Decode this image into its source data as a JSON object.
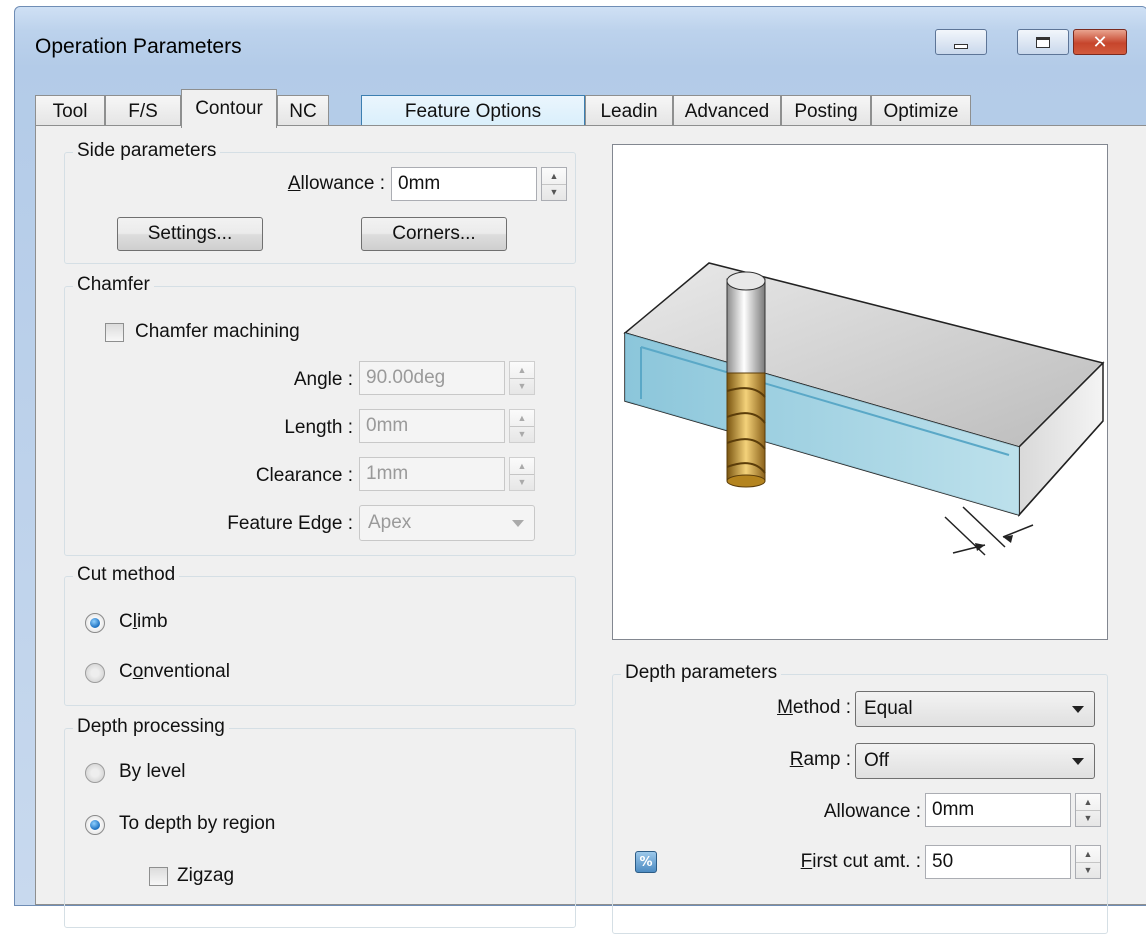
{
  "window": {
    "title": "Operation Parameters",
    "minimize_glyph": "—",
    "close_glyph": "✕"
  },
  "tabs": [
    {
      "label": "Tool"
    },
    {
      "label": "F/S"
    },
    {
      "label": "Contour",
      "active": true
    },
    {
      "label": "NC"
    },
    {
      "label": "Feature Options",
      "hover": true
    },
    {
      "label": "Leadin"
    },
    {
      "label": "Advanced"
    },
    {
      "label": "Posting"
    },
    {
      "label": "Optimize"
    }
  ],
  "side_parameters": {
    "group_label": "Side parameters",
    "allowance_label": "Allowance :",
    "allowance_value": "0mm",
    "settings_button": "Settings...",
    "corners_button": "Corners..."
  },
  "chamfer": {
    "group_label": "Chamfer",
    "checkbox_label": "Chamfer machining",
    "checked": false,
    "angle_label": "Angle :",
    "angle_value": "90.00deg",
    "length_label": "Length :",
    "length_value": "0mm",
    "clearance_label": "Clearance :",
    "clearance_value": "1mm",
    "feature_edge_label": "Feature Edge :",
    "feature_edge_value": "Apex"
  },
  "cut_method": {
    "group_label": "Cut method",
    "options": [
      {
        "label": "Climb",
        "selected": true
      },
      {
        "label": "Conventional",
        "selected": false
      }
    ]
  },
  "depth_processing": {
    "group_label": "Depth processing",
    "options": [
      {
        "label": "By level",
        "selected": false
      },
      {
        "label": "To depth by region",
        "selected": true
      }
    ],
    "zigzag_label": "Zigzag",
    "zigzag_checked": false
  },
  "depth_parameters": {
    "group_label": "Depth parameters",
    "method_label": "Method :",
    "method_value": "Equal",
    "ramp_label": "Ramp :",
    "ramp_value": "Off",
    "allowance_label": "Allowance :",
    "allowance_value": "0mm",
    "first_cut_label": "First cut amt. :",
    "first_cut_value": "50",
    "percent_icon_glyph": "%"
  },
  "colors": {
    "accent_blue": "#1b6fbf",
    "tool_gold": "#c89a2c",
    "wall_highlight": "#8fd3ea"
  }
}
